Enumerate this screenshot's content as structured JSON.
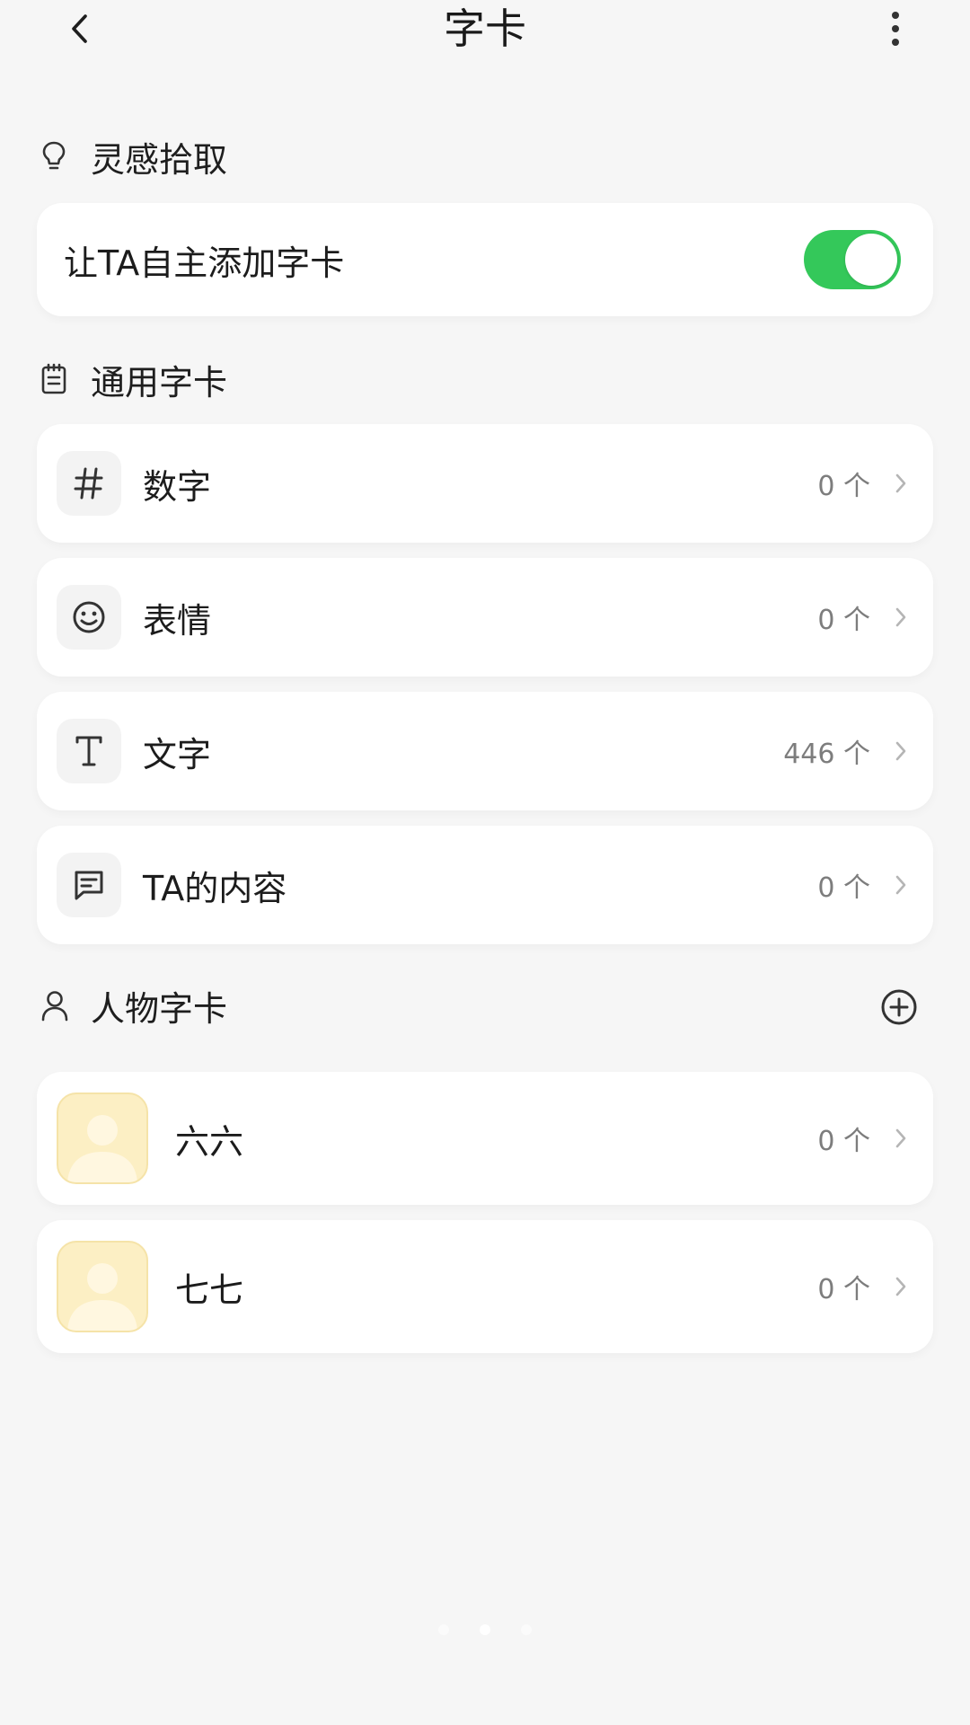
{
  "header": {
    "title": "字卡"
  },
  "inspiration": {
    "label": "灵感拾取",
    "toggle_label": "让TA自主添加字卡",
    "toggle_on": true,
    "toggle_color": "#34c85a"
  },
  "general": {
    "label": "通用字卡",
    "items": [
      {
        "label": "数字",
        "count": "0 个",
        "icon": "hash-icon"
      },
      {
        "label": "表情",
        "count": "0 个",
        "icon": "smiley-icon"
      },
      {
        "label": "文字",
        "count": "446 个",
        "icon": "text-icon"
      },
      {
        "label": "TA的内容",
        "count": "0 个",
        "icon": "message-icon"
      }
    ]
  },
  "people": {
    "label": "人物字卡",
    "items": [
      {
        "name": "六六",
        "count": "0 个"
      },
      {
        "name": "七七",
        "count": "0 个"
      }
    ]
  },
  "pager": {
    "count": 3,
    "active": 1
  }
}
